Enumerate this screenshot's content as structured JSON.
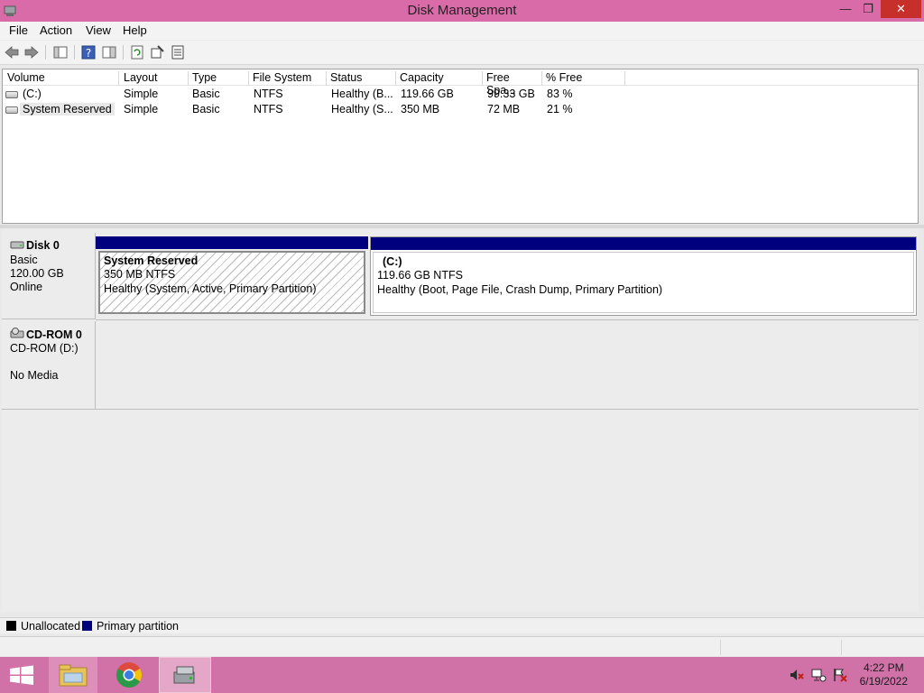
{
  "window": {
    "title": "Disk Management"
  },
  "menu": [
    "File",
    "Action",
    "View",
    "Help"
  ],
  "volume_list": {
    "columns": [
      "Volume",
      "Layout",
      "Type",
      "File System",
      "Status",
      "Capacity",
      "Free Spa...",
      "% Free"
    ],
    "rows": [
      {
        "volume": "(C:)",
        "layout": "Simple",
        "type": "Basic",
        "fs": "NTFS",
        "status": "Healthy (B...",
        "capacity": "119.66 GB",
        "free": "99.33 GB",
        "pct": "83 %"
      },
      {
        "volume": "System Reserved",
        "layout": "Simple",
        "type": "Basic",
        "fs": "NTFS",
        "status": "Healthy (S...",
        "capacity": "350 MB",
        "free": "72 MB",
        "pct": "21 %"
      }
    ]
  },
  "disks": [
    {
      "name": "Disk 0",
      "type": "Basic",
      "size": "120.00 GB",
      "state": "Online",
      "partitions": [
        {
          "name": "System Reserved",
          "size": "350 MB NTFS",
          "status": "Healthy (System, Active, Primary Partition)"
        },
        {
          "name": "(C:)",
          "size": "119.66 GB NTFS",
          "status": "Healthy (Boot, Page File, Crash Dump, Primary Partition)"
        }
      ]
    },
    {
      "name": "CD-ROM 0",
      "type": "CD-ROM (D:)",
      "state": "No Media"
    }
  ],
  "legend": [
    {
      "label": "Unallocated",
      "color": "#000000"
    },
    {
      "label": "Primary partition",
      "color": "#00007f"
    }
  ],
  "taskbar": {
    "time": "4:22 PM",
    "date": "6/19/2022"
  },
  "colors": {
    "titlebar": "#d86ba8",
    "taskbar": "#d072a8",
    "partition_bar": "#00007f",
    "close": "#c7302a"
  }
}
